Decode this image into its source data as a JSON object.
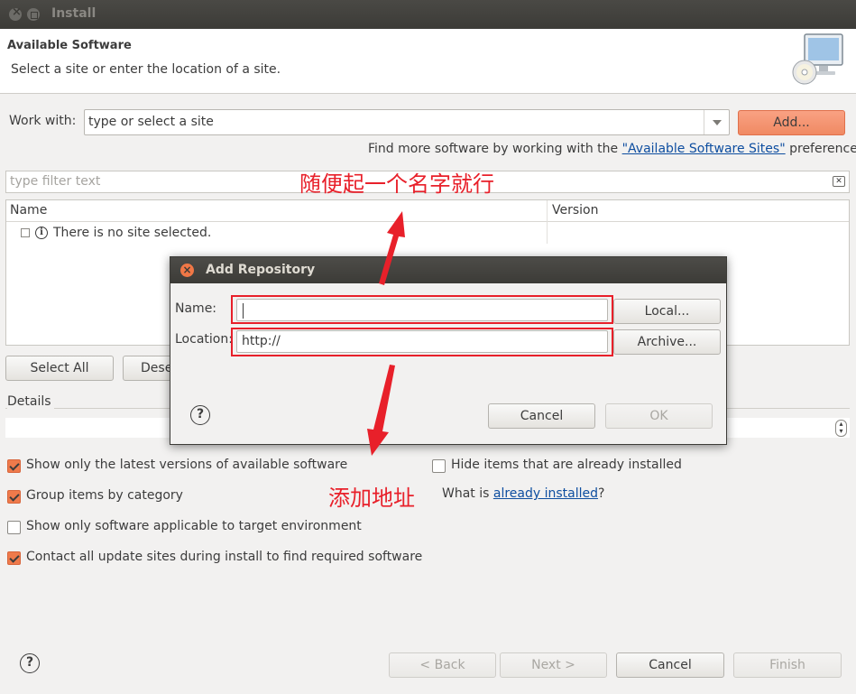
{
  "window": {
    "title": "Install"
  },
  "header": {
    "title": "Available Software",
    "description": "Select a site or enter the location of a site."
  },
  "work_with": {
    "label": "Work with:",
    "value": "type or select a site",
    "add_button": "Add...",
    "find_more_prefix": "Find more software by working with the ",
    "find_more_link": "\"Available Software Sites\"",
    "find_more_suffix": " preferences."
  },
  "filter": {
    "placeholder": "type filter text"
  },
  "table": {
    "columns": [
      "Name",
      "Version"
    ],
    "rows": [
      {
        "text": "There is no site selected."
      }
    ]
  },
  "buttons": {
    "select_all": "Select All",
    "deselect": "Dese"
  },
  "details": {
    "label": "Details"
  },
  "options": {
    "latest_versions": "Show only the latest versions of available software",
    "group_by_category": "Group items by category",
    "applicable_only": "Show only software applicable to target environment",
    "contact_all": "Contact all update sites during install to find required software",
    "hide_installed": "Hide items that are already installed",
    "what_is_prefix": "What is ",
    "what_is_link": "already installed",
    "what_is_suffix": "?"
  },
  "option_states": {
    "latest_versions": true,
    "group_by_category": true,
    "applicable_only": false,
    "contact_all": true,
    "hide_installed": false
  },
  "footer": {
    "back": "< Back",
    "next": "Next >",
    "cancel": "Cancel",
    "finish": "Finish"
  },
  "dialog": {
    "title": "Add Repository",
    "name_label": "Name:",
    "name_value": "",
    "location_label": "Location:",
    "location_value": "http://",
    "local_button": "Local...",
    "archive_button": "Archive...",
    "cancel_button": "Cancel",
    "ok_button": "OK"
  },
  "annotations": {
    "name_hint": "随便起一个名字就行",
    "location_hint": "添加地址"
  },
  "colors": {
    "accent": "#f08a63",
    "annotation": "#e8202a",
    "titlebar": "#3c3b37",
    "link": "#0e4ea0"
  }
}
